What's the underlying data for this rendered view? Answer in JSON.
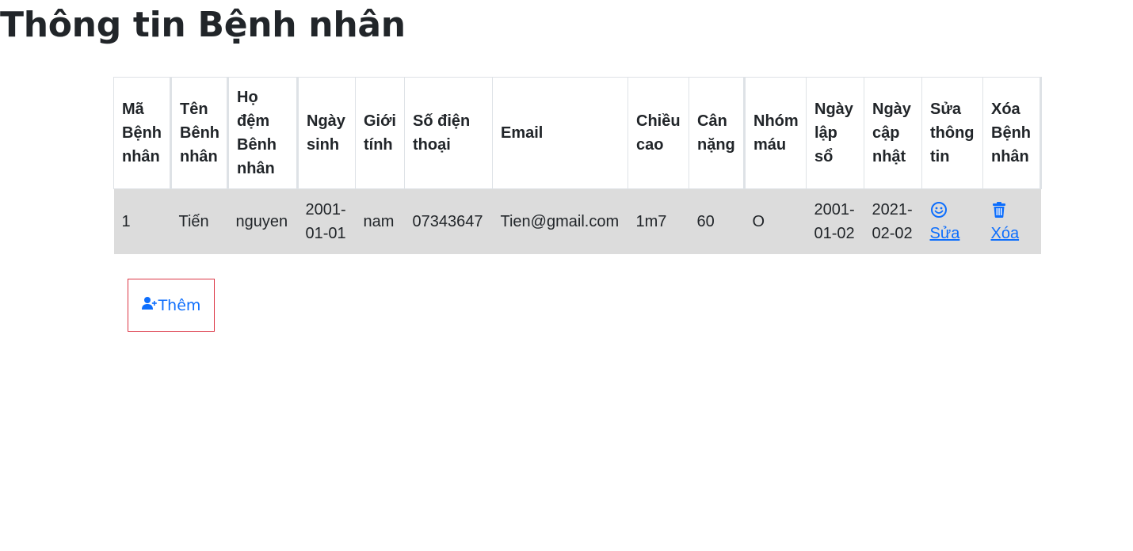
{
  "page": {
    "title": "Thông tin Bệnh nhân"
  },
  "table": {
    "headers": [
      "Mã Bệnh nhân",
      "Tên Bênh nhân",
      "Họ đệm Bênh nhân",
      "Ngày sinh",
      "Giới tính",
      "Số điện thoại",
      "Email",
      "Chiều cao",
      "Cân nặng",
      "Nhóm máu",
      "Ngày lập sổ",
      "Ngày cập nhật",
      "Sửa thông tin",
      "Xóa Bệnh nhân"
    ],
    "rows": [
      {
        "id": "1",
        "first_name": "Tiến",
        "last_name": "nguyen",
        "dob": "2001-01-01",
        "gender": "nam",
        "phone": "07343647",
        "email": "Tien@gmail.com",
        "height": "1m7",
        "weight": "60",
        "blood_type": "O",
        "created": "2001-01-02",
        "updated": "2021-02-02",
        "edit_label": "Sửa",
        "delete_label": "Xóa"
      }
    ]
  },
  "icons": {
    "edit": "smile-icon",
    "delete": "trash-icon",
    "add": "user-plus-icon"
  },
  "add_button": {
    "label": "Thêm"
  },
  "colors": {
    "link": "#0d6efd",
    "row_bg": "#dcdcdc",
    "add_border": "#dc3545"
  }
}
